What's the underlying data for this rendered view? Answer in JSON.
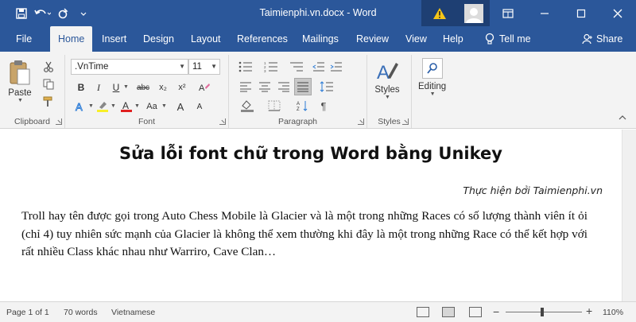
{
  "titlebar": {
    "doc_title": "Taimienphi.vn.docx - Word",
    "bg_color": "#2b579a",
    "quick_access": [
      "save-icon",
      "undo-icon",
      "redo-icon",
      "customize-icon"
    ],
    "window_buttons": [
      "warning-icon",
      "account-icon",
      "ribbon-display-icon",
      "minimize-icon",
      "maximize-icon",
      "close-icon"
    ]
  },
  "tabs": [
    {
      "label": "File"
    },
    {
      "label": "Home",
      "active": true
    },
    {
      "label": "Insert"
    },
    {
      "label": "Design"
    },
    {
      "label": "Layout"
    },
    {
      "label": "References"
    },
    {
      "label": "Mailings"
    },
    {
      "label": "Review"
    },
    {
      "label": "View"
    },
    {
      "label": "Help"
    }
  ],
  "tell_me": "Tell me",
  "share": "Share",
  "ribbon": {
    "clipboard": {
      "label": "Clipboard",
      "paste": "Paste"
    },
    "font": {
      "label": "Font",
      "font_name": ".VnTime",
      "font_size": "11",
      "buttons": [
        "B",
        "I",
        "U",
        "abc",
        "x₂",
        "x²",
        "A",
        "Aa",
        "A",
        "A"
      ]
    },
    "paragraph": {
      "label": "Paragraph"
    },
    "styles": {
      "label": "Styles",
      "button": "Styles"
    },
    "editing": {
      "button": "Editing"
    }
  },
  "document": {
    "heading": "Sửa lỗi font chữ trong Word bằng Unikey",
    "byline": "Thực hiện bởi Taimienphi.vn",
    "body": "Troll hay tên được gọi trong Auto Chess Mobile là Glacier và là một trong những Races có số lượng thành viên ít ỏi (chỉ 4) tuy nhiên sức mạnh của Glacier là không thể xem thường khi đây là một trong những Race có thể kết hợp với rất nhiều Class khác nhau như Warriro, Cave Clan…"
  },
  "statusbar": {
    "page": "Page 1 of 1",
    "words": "70 words",
    "language": "Vietnamese",
    "zoom_minus": "−",
    "zoom_plus": "+",
    "zoom": "110%"
  }
}
